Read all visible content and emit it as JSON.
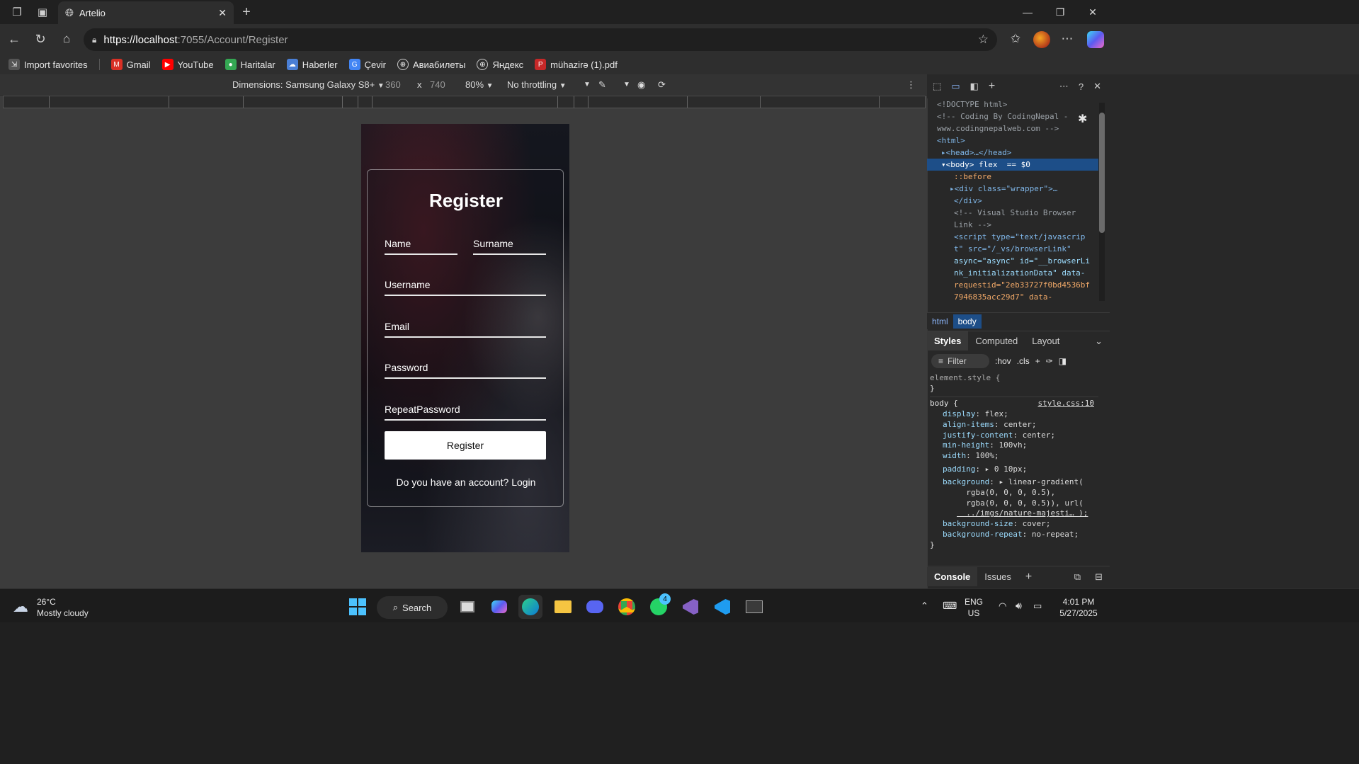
{
  "browser": {
    "tab_title": "Artelio",
    "url_host": "https://localhost",
    "url_rest": ":7055/Account/Register",
    "favorites": [
      {
        "label": "Import favorites",
        "icon": "import-icon",
        "color": "#5b5b5b"
      },
      {
        "label": "Gmail",
        "icon": "gmail-icon",
        "color": "#d93025"
      },
      {
        "label": "YouTube",
        "icon": "youtube-icon",
        "color": "#ff0000"
      },
      {
        "label": "Haritalar",
        "icon": "maps-icon",
        "color": "#34a853"
      },
      {
        "label": "Haberler",
        "icon": "news-icon",
        "color": "#4a7fd6"
      },
      {
        "label": "Çevir",
        "icon": "translate-icon",
        "color": "#4285f4"
      },
      {
        "label": "Авиабилеты",
        "icon": "globe-icon",
        "color": "#555555"
      },
      {
        "label": "Яндекс",
        "icon": "globe-icon",
        "color": "#555555"
      },
      {
        "label": "mühazirə (1).pdf",
        "icon": "pdf-icon",
        "color": "#c62828"
      }
    ]
  },
  "device_toolbar": {
    "dimensions_label": "Dimensions: Samsung Galaxy S8+",
    "width": "360",
    "times": "x",
    "height": "740",
    "zoom": "80%",
    "throttling": "No throttling"
  },
  "page": {
    "title": "Register",
    "fields": {
      "name": "Name",
      "surname": "Surname",
      "username": "Username",
      "email": "Email",
      "password": "Password",
      "repeat_password": "RepeatPassword"
    },
    "button": "Register",
    "login_prompt": "Do you have an account? Login"
  },
  "devtools": {
    "dom_lines": [
      {
        "text": "<!DOCTYPE html>",
        "kind": "cm",
        "indent": 0
      },
      {
        "text": "<!-- Coding By CodingNepal -",
        "kind": "cm",
        "indent": 0
      },
      {
        "text": "www.codingnepalweb.com -->",
        "kind": "cm",
        "indent": 0
      },
      {
        "text": "<html>",
        "kind": "tag",
        "indent": 0
      },
      {
        "text": "▸<head>…</head>",
        "kind": "tag",
        "indent": 0
      },
      {
        "text": "▾<body> flex  == $0",
        "kind": "sel",
        "indent": 0
      },
      {
        "text": "::before",
        "kind": "val",
        "indent": 1
      },
      {
        "text": "▸<div class=\"wrapper\">…",
        "kind": "tag",
        "indent": 1
      },
      {
        "text": "</div>",
        "kind": "tag",
        "indent": 1
      },
      {
        "text": "<!-- Visual Studio Browser",
        "kind": "cm",
        "indent": 1
      },
      {
        "text": "Link -->",
        "kind": "cm",
        "indent": 1
      },
      {
        "text": "<script type=\"text/javascrip",
        "kind": "tag",
        "indent": 1
      },
      {
        "text": "t\" src=\"/_vs/browserLink\"",
        "kind": "tag",
        "indent": 1
      },
      {
        "text": "async=\"async\" id=\"__browserLi",
        "kind": "tag",
        "indent": 1
      },
      {
        "text": "nk_initializationData\" data-",
        "kind": "tag",
        "indent": 1
      },
      {
        "text": "requestid=\"2eb33727f0bd4536bf",
        "kind": "val",
        "indent": 1
      },
      {
        "text": "7946835acc29d7\" data-",
        "kind": "val",
        "indent": 1
      }
    ],
    "crumbs": [
      "html",
      "body"
    ],
    "style_tabs": [
      "Styles",
      "Computed",
      "Layout"
    ],
    "filter_placeholder": "Filter",
    "hov": ":hov",
    "cls": ".cls",
    "element_style": "element.style {",
    "close_brace": "}",
    "body_selector": "body {",
    "source": "style.css:10",
    "rules": [
      {
        "prop": "display",
        "value": "flex;"
      },
      {
        "prop": "align-items",
        "value": "center;"
      },
      {
        "prop": "justify-content",
        "value": "center;"
      },
      {
        "prop": "min-height",
        "value": "100vh;"
      },
      {
        "prop": "width",
        "value": "100%;"
      },
      {
        "prop": "padding",
        "value": "▸ 0 10px;"
      },
      {
        "prop": "background",
        "value": "▸ linear-gradient("
      },
      {
        "prop": "",
        "value": "  rgba(0, 0, 0, 0.5),"
      },
      {
        "prop": "",
        "value": "  rgba(0, 0, 0, 0.5)), url("
      },
      {
        "prop": "",
        "value": "  ../imgs/nature-majesti… );"
      },
      {
        "prop": "background-size",
        "value": "cover;"
      },
      {
        "prop": "background-repeat",
        "value": "no-repeat;"
      }
    ],
    "bottom_tabs": [
      "Console",
      "Issues"
    ]
  },
  "taskbar": {
    "weather_temp": "26°C",
    "weather_desc": "Mostly cloudy",
    "search_label": "Search",
    "whatsapp_badge": "4",
    "lang": "ENG",
    "region": "US",
    "time": "4:01 PM",
    "date": "5/27/2025"
  }
}
